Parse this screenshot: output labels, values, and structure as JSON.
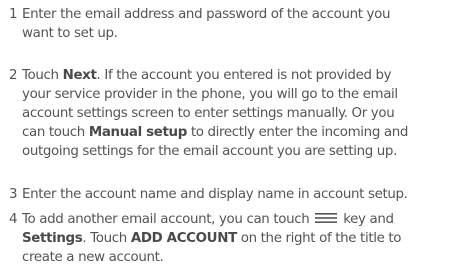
{
  "steps": [
    {
      "number": "1",
      "line1": "Enter the email address and password of the account you",
      "line2": "want to set up."
    },
    {
      "number": "2",
      "touch": "Touch ",
      "next": "Next",
      "after_next": ". If the account you entered is not provided by",
      "line2": "your service provider in the phone, you will go to the email",
      "line3": "account settings screen to enter settings manually. Or you",
      "can_touch": "can touch ",
      "manual_setup": "Manual setup",
      "after_manual": " to directly enter the incoming and",
      "line5": "outgoing settings for the email account you are setting up."
    },
    {
      "number": "3",
      "line1": "Enter the account name and display name in account setup."
    },
    {
      "number": "4",
      "before_icon": "To add another email account, you can touch ",
      "menu_icon": "menu-icon",
      "after_icon": " key and",
      "settings": "Settings",
      "touch": ". Touch ",
      "add_account": "ADD ACCOUNT",
      "after_add": " on the right of the title to",
      "line3": "create a new account."
    }
  ]
}
